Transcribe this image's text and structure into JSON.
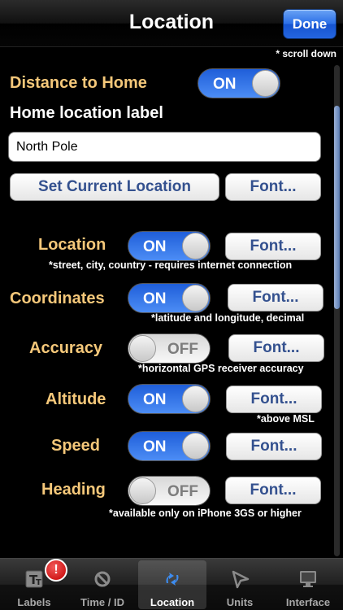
{
  "nav": {
    "title": "Location",
    "done_label": "Done",
    "scroll_note": "* scroll down"
  },
  "distance": {
    "label": "Distance to Home",
    "toggle": "ON"
  },
  "home": {
    "label": "Home location label",
    "value": "North Pole",
    "set_button": "Set Current Location",
    "font_button": "Font..."
  },
  "rows": [
    {
      "label": "Location",
      "toggle": "ON",
      "font_button": "Font...",
      "note": "*street, city, country - requires internet connection"
    },
    {
      "label": "Coordinates",
      "toggle": "ON",
      "font_button": "Font...",
      "note": "*latitude and longitude, decimal"
    },
    {
      "label": "Accuracy",
      "toggle": "OFF",
      "font_button": "Font...",
      "note": "*horizontal GPS receiver accuracy"
    },
    {
      "label": "Altitude",
      "toggle": "ON",
      "font_button": "Font...",
      "note": "*above MSL"
    },
    {
      "label": "Speed",
      "toggle": "ON",
      "font_button": "Font...",
      "note": ""
    },
    {
      "label": "Heading",
      "toggle": "OFF",
      "font_button": "Font...",
      "note": "*available only on iPhone 3GS or higher"
    }
  ],
  "tabs": [
    {
      "label": "Labels",
      "icon": "text-icon",
      "badge": "!"
    },
    {
      "label": "Time / ID",
      "icon": "no-sign-icon"
    },
    {
      "label": "Location",
      "icon": "location-arrows-icon",
      "selected": true
    },
    {
      "label": "Units",
      "icon": "cursor-icon"
    },
    {
      "label": "Interface",
      "icon": "monitor-icon"
    }
  ],
  "colors": {
    "accent": "#2a6ee6",
    "label_gold": "#f5c87a",
    "button_text": "#34518f"
  }
}
